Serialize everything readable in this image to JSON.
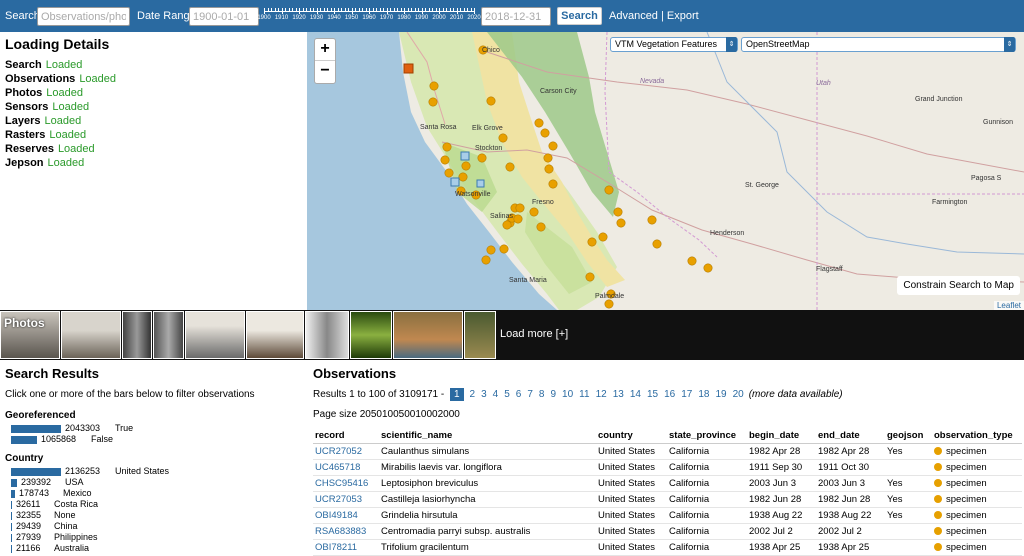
{
  "topbar": {
    "search_label": "Search",
    "search_placeholder": "Observations/photo",
    "date_range_label": "Date Range",
    "date_start": "1900-01-01",
    "date_end": "2018-12-31",
    "slider_years": [
      "1900",
      "1910",
      "1920",
      "1930",
      "1940",
      "1950",
      "1960",
      "1970",
      "1980",
      "1990",
      "2000",
      "2010",
      "2020"
    ],
    "search_button": "Search",
    "advanced_link": "Advanced",
    "separator": "|",
    "export_link": "Export"
  },
  "loading": {
    "title": "Loading Details",
    "items": [
      {
        "name": "Search",
        "status": "Loaded"
      },
      {
        "name": "Observations",
        "status": "Loaded"
      },
      {
        "name": "Photos",
        "status": "Loaded"
      },
      {
        "name": "Sensors",
        "status": "Loaded"
      },
      {
        "name": "Layers",
        "status": "Loaded"
      },
      {
        "name": "Rasters",
        "status": "Loaded"
      },
      {
        "name": "Reserves",
        "status": "Loaded"
      },
      {
        "name": "Jepson",
        "status": "Loaded"
      }
    ]
  },
  "map": {
    "zoom_in": "+",
    "zoom_out": "−",
    "layer_select": "VTM Vegetation Features",
    "basemap_select": "OpenStreetMap",
    "constrain": "Constrain Search to Map",
    "attribution": "Leaflet",
    "labels": [
      "Nevada",
      "Utah",
      "Santa Rosa",
      "Elk Grove",
      "Carson City",
      "Stockton",
      "Fresno",
      "Watsonville",
      "Salinas",
      "Santa Maria",
      "Palmdale",
      "St. George",
      "Henderson",
      "Flagstaff",
      "Farmington",
      "Grand Junction",
      "Gunnison",
      "Pagosa S",
      "Chico"
    ]
  },
  "photos": {
    "label": "Photos",
    "load_more": "Load more [+]"
  },
  "search_results": {
    "title": "Search Results",
    "hint": "Click one or more of the bars below to filter observations",
    "georeferenced": {
      "title": "Georeferenced",
      "rows": [
        {
          "count": 2043303,
          "label": "True"
        },
        {
          "count": 1065868,
          "label": "False"
        }
      ]
    },
    "country": {
      "title": "Country",
      "rows": [
        {
          "count": 2136253,
          "label": "United States"
        },
        {
          "count": 239392,
          "label": "USA"
        },
        {
          "count": 178743,
          "label": "Mexico"
        },
        {
          "count": 32611,
          "label": "Costa Rica"
        },
        {
          "count": 32355,
          "label": "None"
        },
        {
          "count": 29439,
          "label": "China"
        },
        {
          "count": 27939,
          "label": "Philippines"
        },
        {
          "count": 21166,
          "label": "Australia"
        }
      ]
    }
  },
  "observations": {
    "title": "Observations",
    "results_text": "Results 1 to 100 of 3109171 -",
    "pages": [
      "1",
      "2",
      "3",
      "4",
      "5",
      "6",
      "7",
      "8",
      "9",
      "10",
      "11",
      "12",
      "13",
      "14",
      "15",
      "16",
      "17",
      "18",
      "19",
      "20"
    ],
    "more_note": "(more data available)",
    "page_size_label": "Page size",
    "page_sizes": [
      "20",
      "50",
      "100",
      "500",
      "1000",
      "2000"
    ],
    "current_page_size": "100",
    "columns": [
      "record",
      "scientific_name",
      "country",
      "state_province",
      "begin_date",
      "end_date",
      "geojson",
      "observation_type"
    ],
    "rows": [
      [
        "UCR27052",
        "Caulanthus simulans",
        "United States",
        "California",
        "1982 Apr 28",
        "1982 Apr 28",
        "Yes",
        "specimen"
      ],
      [
        "UC465718",
        "Mirabilis laevis var. longiflora",
        "United States",
        "California",
        "1911 Sep 30",
        "1911 Oct 30",
        "",
        "specimen"
      ],
      [
        "CHSC95416",
        "Leptosiphon breviculus",
        "United States",
        "California",
        "2003 Jun 3",
        "2003 Jun 3",
        "Yes",
        "specimen"
      ],
      [
        "UCR27053",
        "Castilleja lasiorhyncha",
        "United States",
        "California",
        "1982 Jun 28",
        "1982 Jun 28",
        "Yes",
        "specimen"
      ],
      [
        "OBI49184",
        "Grindelia hirsutula",
        "United States",
        "California",
        "1938 Aug 22",
        "1938 Aug 22",
        "Yes",
        "specimen"
      ],
      [
        "RSA683883",
        "Centromadia parryi subsp. australis",
        "United States",
        "California",
        "2002 Jul 2",
        "2002 Jul 2",
        "",
        "specimen"
      ],
      [
        "OBI78211",
        "Trifolium gracilentum",
        "United States",
        "California",
        "1938 Apr 25",
        "1938 Apr 25",
        "",
        "specimen"
      ]
    ]
  }
}
